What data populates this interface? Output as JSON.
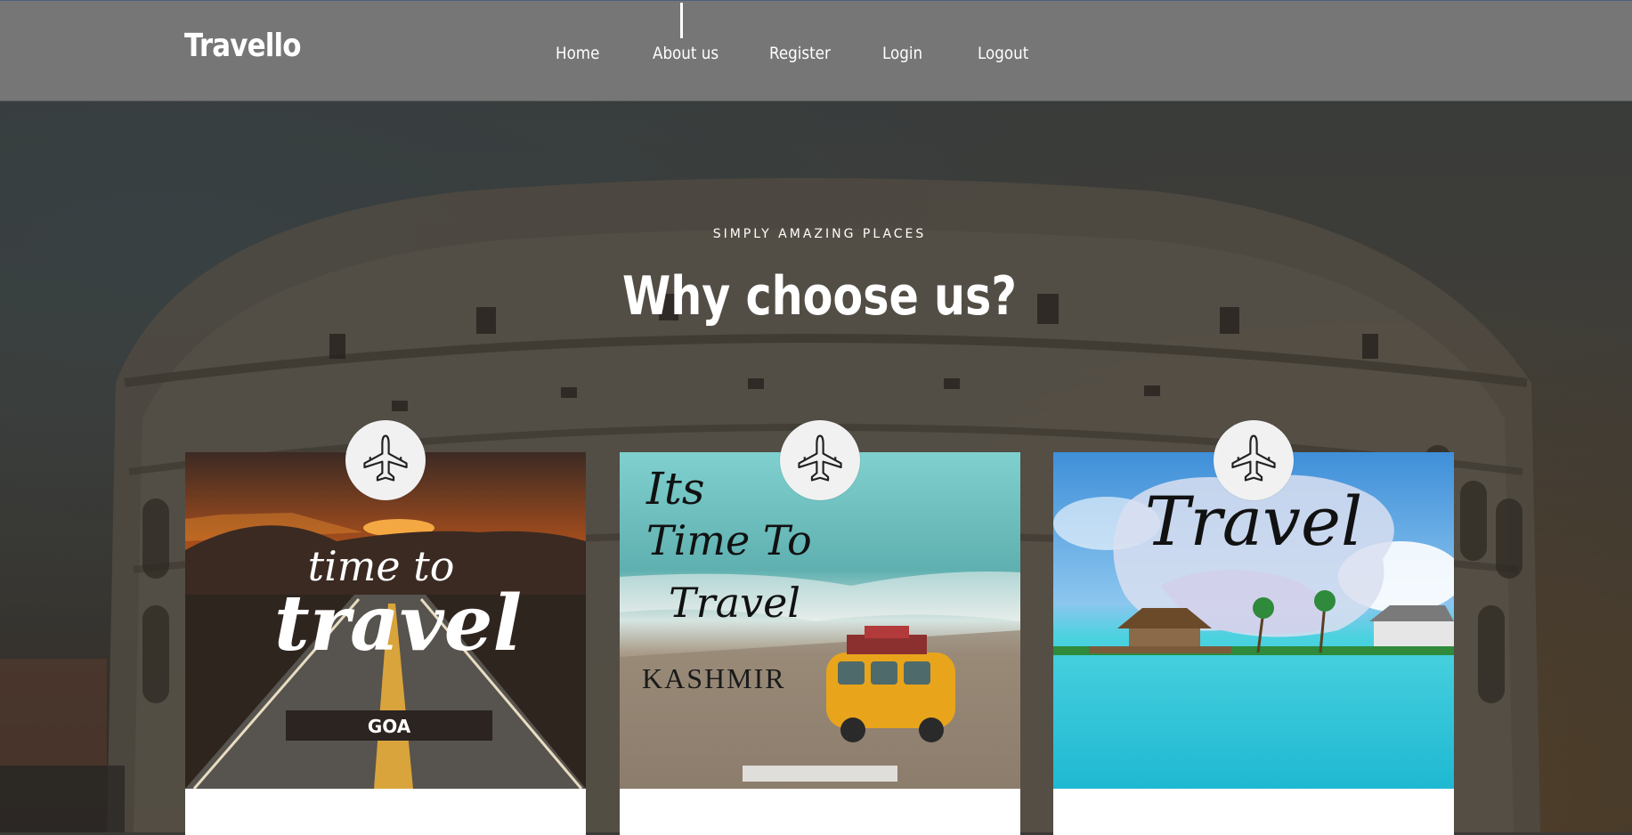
{
  "navbar": {
    "brand": "Travello",
    "links": [
      {
        "label": "Home"
      },
      {
        "label": "About us"
      },
      {
        "label": "Register"
      },
      {
        "label": "Login"
      },
      {
        "label": "Logout"
      }
    ]
  },
  "hero": {
    "eyebrow": "SIMPLY AMAZING PLACES",
    "headline": "Why choose us?",
    "background_icon": "colosseum-photo"
  },
  "cards": [
    {
      "icon": "airplane-icon",
      "image": "goa-road-sunset",
      "line1": "time to",
      "line2": "travel",
      "tag": "GOA"
    },
    {
      "icon": "airplane-icon",
      "image": "kashmir-toy-van-beach",
      "line1": "Its",
      "line2": "Time To",
      "line3": "Travel",
      "tag": "KASHMIR"
    },
    {
      "icon": "airplane-icon",
      "image": "island-beach-resort",
      "line1": "Travel"
    }
  ],
  "colors": {
    "navbar_bg": "#767676",
    "text": "#ffffff",
    "card_bg": "#ffffff",
    "badge_bg": "#f1f1f1"
  }
}
